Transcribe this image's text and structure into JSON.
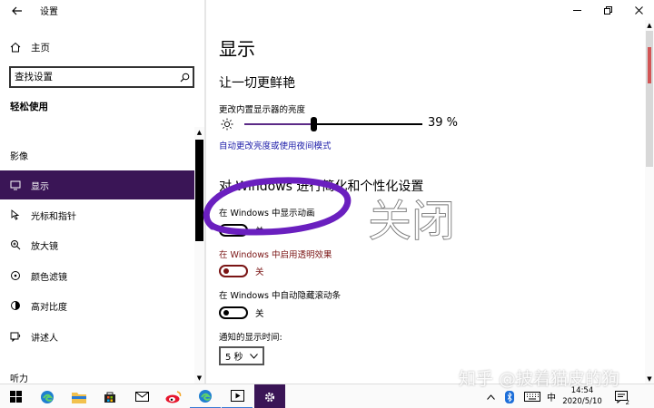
{
  "app": {
    "title": "设置"
  },
  "sidebar": {
    "home": "主页",
    "search_placeholder": "查找设置",
    "group_title": "轻松使用",
    "items": [
      {
        "label": "影像",
        "icon": "",
        "active": false
      },
      {
        "label": "显示",
        "icon": "monitor-icon",
        "active": true
      },
      {
        "label": "光标和指针",
        "icon": "cursor-icon",
        "active": false
      },
      {
        "label": "放大镜",
        "icon": "magnifier-icon",
        "active": false
      },
      {
        "label": "颜色滤镜",
        "icon": "color-filter-icon",
        "active": false
      },
      {
        "label": "高对比度",
        "icon": "contrast-icon",
        "active": false
      },
      {
        "label": "讲述人",
        "icon": "narrator-icon",
        "active": false
      },
      {
        "label": "听力",
        "icon": "",
        "active": false
      }
    ]
  },
  "main": {
    "page_title": "显示",
    "section1": {
      "title": "让一切更鲜艳",
      "brightness_label": "更改内置显示器的亮度",
      "brightness_value": 39,
      "brightness_text": "39 %",
      "link": "自动更改亮度或使用夜间模式"
    },
    "section2": {
      "title": "对 Windows 进行简化和个性化设置",
      "animations_label": "在 Windows 中显示动画",
      "animations_state": "关",
      "transparency_label": "在 Windows 中启用透明效果",
      "transparency_state": "关",
      "scrollbars_label": "在 Windows 中自动隐藏滚动条",
      "scrollbars_state": "关",
      "notification_label": "通知的显示时间:",
      "notification_value": "5 秒"
    }
  },
  "annotation": {
    "handwritten": "关闭"
  },
  "watermark": "知乎 @披着猫皮的狗",
  "taskbar": {
    "ime": "中",
    "time": "14:54",
    "date": "2020/5/10",
    "notifications": "2"
  },
  "colors": {
    "accent": "#3a1556",
    "annotation": "#6a1fbf",
    "warning": "#7a1414",
    "link": "#1a1aa8"
  }
}
